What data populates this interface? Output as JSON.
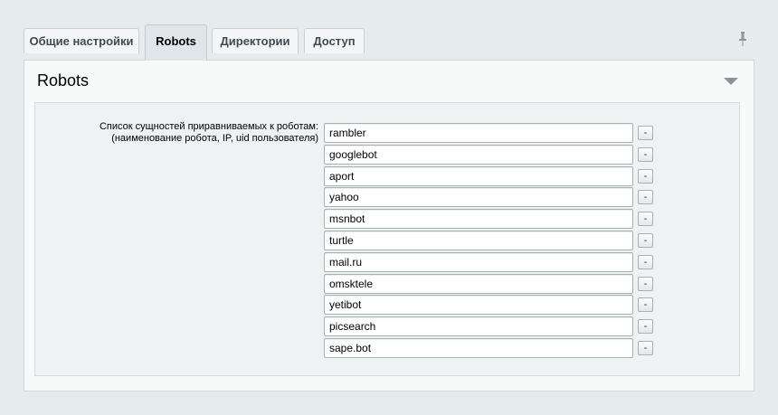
{
  "tabs": [
    {
      "label": "Общие настройки",
      "active": false
    },
    {
      "label": "Robots",
      "active": true
    },
    {
      "label": "Директории",
      "active": false
    },
    {
      "label": "Доступ",
      "active": false
    }
  ],
  "icons": {
    "pin": "pin-icon",
    "collapse": "triangle-down-icon"
  },
  "section": {
    "title": "Robots",
    "field_label_line1": "Список сущностей приравниваемых к роботам:",
    "field_label_line2": "(наименование робота, IP, uid пользователя)",
    "remove_label": "-",
    "entries": [
      "rambler",
      "googlebot",
      "aport",
      "yahoo",
      "msnbot",
      "turtle",
      "mail.ru",
      "omsktele",
      "yetibot",
      "picsearch",
      "sape.bot"
    ]
  }
}
